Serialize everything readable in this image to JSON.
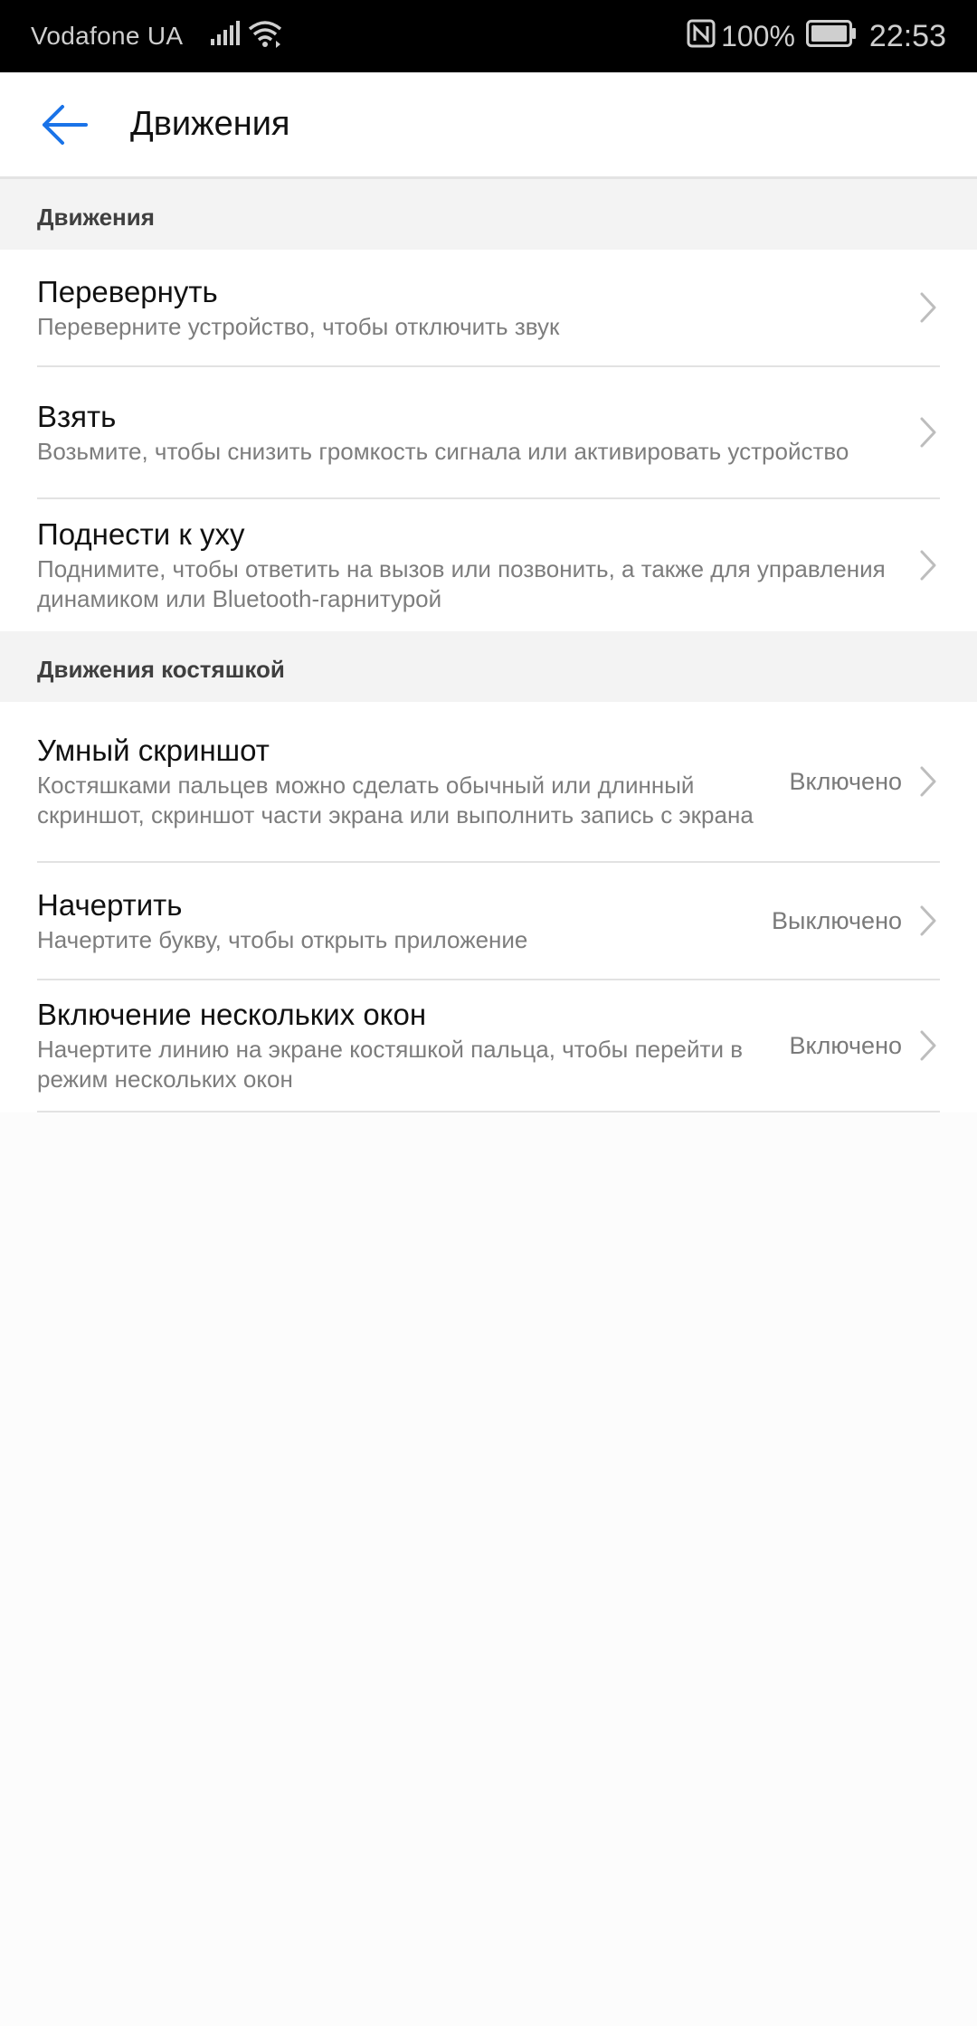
{
  "status_bar": {
    "carrier": "Vodafone UA",
    "battery": "100%",
    "time": "22:53",
    "icons": [
      "signal-icon",
      "wifi-icon",
      "nfc-icon",
      "battery-icon"
    ]
  },
  "app_bar": {
    "title": "Движения",
    "back_icon": "arrow-left-icon",
    "accent_color": "#1a73e8"
  },
  "sections": [
    {
      "header": "Движения",
      "items": [
        {
          "title": "Перевернуть",
          "description": "Переверните устройство, чтобы отключить звук",
          "status": ""
        },
        {
          "title": "Взять",
          "description": "Возьмите, чтобы снизить громкость сигнала или активировать устройство",
          "status": ""
        },
        {
          "title": "Поднести к уху",
          "description": "Поднимите, чтобы ответить на вызов или позвонить, а также для управления динамиком или Bluetooth-гарнитурой",
          "status": ""
        }
      ]
    },
    {
      "header": "Движения костяшкой",
      "items": [
        {
          "title": "Умный скриншот",
          "description": "Костяшками пальцев можно сделать обычный или длинный скриншот, скриншот части экрана или выполнить запись с экрана",
          "status": "Включено"
        },
        {
          "title": "Начертить",
          "description": "Начертите букву, чтобы открыть приложение",
          "status": "Выключено"
        },
        {
          "title": "Включение нескольких окон",
          "description": "Начертите линию на экране костяшкой пальца, чтобы перейти в режим нескольких окон",
          "status": "Включено"
        }
      ]
    }
  ]
}
